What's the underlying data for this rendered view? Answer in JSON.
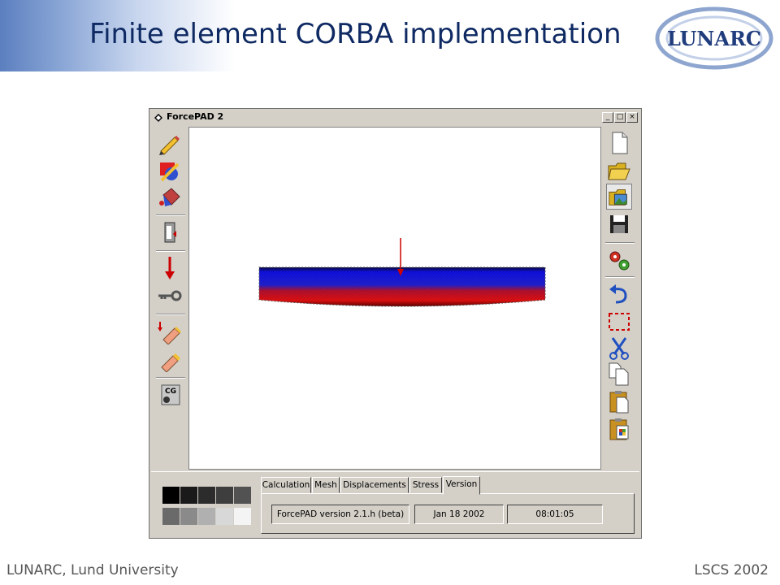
{
  "slide": {
    "title": "Finite element CORBA implementation",
    "footer_left": "LUNARC, Lund University",
    "footer_right": "LSCS 2002",
    "logo_text": "LUNARC"
  },
  "window": {
    "title": "ForcePAD 2",
    "controls": [
      "_",
      "□",
      "×"
    ]
  },
  "left_toolbar": [
    "pencil-icon",
    "shape-fill-icon",
    "paint-bucket-icon",
    "constraint-icon",
    "force-arrow-icon",
    "key-icon",
    "force-eraser-icon",
    "eraser-icon",
    "center-of-gravity-icon"
  ],
  "right_toolbar": [
    "new-file-icon",
    "open-folder-icon",
    "open-image-icon",
    "save-icon",
    "run-calculation-icon",
    "undo-icon",
    "select-rectangle-icon",
    "cut-icon",
    "copy-icon",
    "paste-icon",
    "paste-special-icon"
  ],
  "palette": {
    "row1": [
      "#000000",
      "#1a1a1a",
      "#2c2c2c",
      "#3e3e3e",
      "#525252"
    ],
    "row2": [
      "#6a6a6a",
      "#8a8a8a",
      "#b0b0b0",
      "#d8d8d8",
      "#f4f4f4"
    ]
  },
  "tabs": [
    "Calculation",
    "Mesh",
    "Displacements",
    "Stress",
    "Version"
  ],
  "active_tab": "Version",
  "status": {
    "version": "ForcePAD version 2.1.h (beta)",
    "date": "Jan 18 2002",
    "time": "08:01:05"
  },
  "colors": {
    "title": "#0f2a63",
    "stress_top": "#1010e0",
    "stress_bottom": "#e01010",
    "force_arrow": "#cc0000",
    "window_face": "#d4d0c8"
  }
}
